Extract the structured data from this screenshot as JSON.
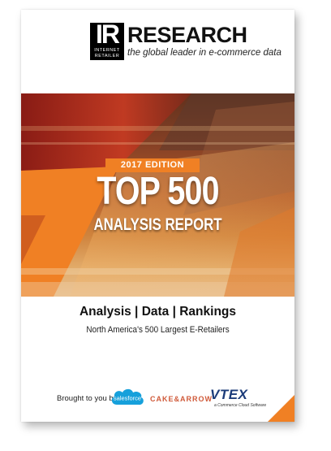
{
  "header": {
    "logo_main": "IR",
    "logo_line1": "INTERNET",
    "logo_line2": "RETAILER",
    "brand": "RESEARCH",
    "tagline": "the global leader in e-commerce data"
  },
  "cover": {
    "edition": "2017 EDITION",
    "title": "TOP 500",
    "subtitle": "ANALYSIS REPORT",
    "headline": "Analysis | Data | Rankings",
    "subheadline": "North America's 500 Largest E-Retailers"
  },
  "sponsors": {
    "intro": "Brought to you by",
    "salesforce": "salesforce",
    "cake_arrow": "CAKE&ARROW",
    "vtex": "VTEX",
    "vtex_sub": "a Commerce Cloud Software"
  },
  "colors": {
    "accent": "#f08024",
    "salesforce": "#16a0db",
    "vtex": "#1c3c7a"
  }
}
